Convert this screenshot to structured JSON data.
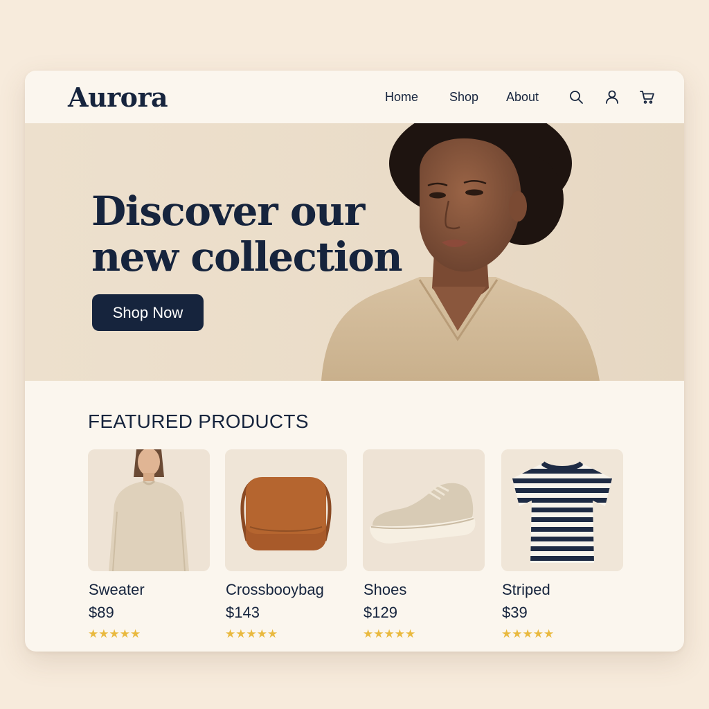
{
  "brand": {
    "name": "Aurora"
  },
  "nav": {
    "items": [
      "Home",
      "Shop",
      "About"
    ],
    "icons": [
      "search-icon",
      "user-icon",
      "cart-icon"
    ]
  },
  "hero": {
    "title_line1": "Discover our",
    "title_line2": "new collection",
    "cta_label": "Shop Now"
  },
  "featured": {
    "heading": "FEATURED PRODUCTS",
    "products": [
      {
        "name": "Sweater",
        "price": "$89",
        "rating": 5,
        "stars": "★★★★★"
      },
      {
        "name": "Crossbooybag",
        "price": "$143",
        "rating": 5,
        "stars": "★★★★★"
      },
      {
        "name": "Shoes",
        "price": "$129",
        "rating": 5,
        "stars": "★★★★★"
      },
      {
        "name": "Striped",
        "price": "$39",
        "rating": 5,
        "stars": "★★★★★"
      }
    ]
  },
  "colors": {
    "background": "#f7ebdc",
    "surface": "#fbf6ee",
    "hero_bg": "#ede0cd",
    "primary": "#16243d",
    "star": "#e9b93f"
  }
}
